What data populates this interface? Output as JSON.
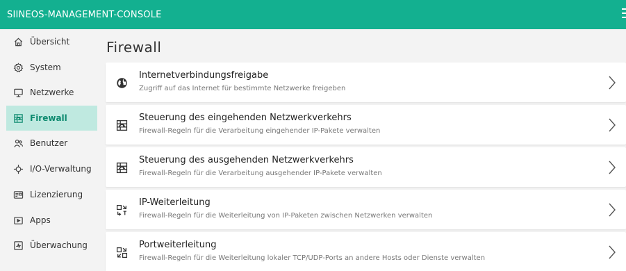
{
  "header": {
    "title": "SIINEOS-MANAGEMENT-CONSOLE",
    "menu_icon": "hamburger-menu-icon"
  },
  "colors": {
    "accent": "#13b090",
    "active_nav_bg": "#bfe9e0",
    "active_nav_text": "#0d8a6f",
    "background": "#f3f3f3"
  },
  "sidebar": {
    "items": [
      {
        "label": "Übersicht",
        "icon": "home-icon",
        "active": false
      },
      {
        "label": "System",
        "icon": "gear-icon",
        "active": false
      },
      {
        "label": "Netzwerke",
        "icon": "monitor-icon",
        "active": false
      },
      {
        "label": "Firewall",
        "icon": "firewall-icon",
        "active": true
      },
      {
        "label": "Benutzer",
        "icon": "users-icon",
        "active": false
      },
      {
        "label": "I/O-Verwaltung",
        "icon": "io-icon",
        "active": false
      },
      {
        "label": "Lizenzierung",
        "icon": "license-icon",
        "active": false
      },
      {
        "label": "Apps",
        "icon": "apps-icon",
        "active": false
      },
      {
        "label": "Überwachung",
        "icon": "monitoring-icon",
        "active": false
      }
    ]
  },
  "main": {
    "title": "Firewall",
    "cards": [
      {
        "title": "Internetverbindungsfreigabe",
        "subtitle": "Zugriff auf das Internet für bestimmte Netzwerke freigeben",
        "icon": "globe-icon"
      },
      {
        "title": "Steuerung des eingehenden Netzwerkverkehrs",
        "subtitle": "Firewall-Regeln für die Verarbeitung eingehender IP-Pakete verwalten",
        "icon": "firewall-icon"
      },
      {
        "title": "Steuerung des ausgehenden Netzwerkverkehrs",
        "subtitle": "Firewall-Regeln für die Verarbeitung ausgehender IP-Pakete verwalten",
        "icon": "firewall-icon"
      },
      {
        "title": "IP-Weiterleitung",
        "subtitle": "Firewall-Regeln für die Weiterleitung von IP-Paketen zwischen Netzwerken verwalten",
        "icon": "ip-forward-icon"
      },
      {
        "title": "Portweiterleitung",
        "subtitle": "Firewall-Regeln für die Weiterleitung lokaler TCP/UDP-Ports an andere Hosts oder Dienste verwalten",
        "icon": "port-forward-icon"
      }
    ]
  }
}
